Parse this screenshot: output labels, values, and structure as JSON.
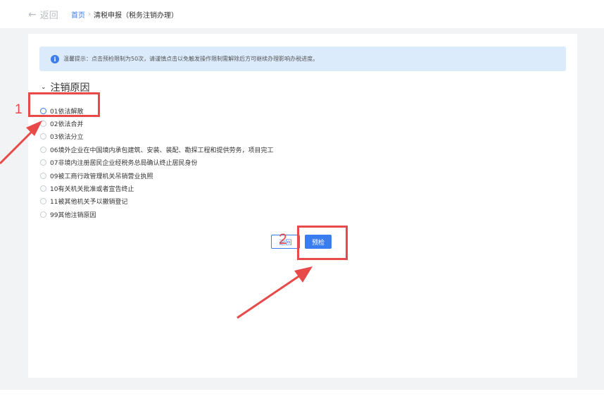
{
  "topbar": {
    "back_arrow": "←",
    "back_label": "返回",
    "breadcrumb": {
      "home": "首页",
      "separator": "›",
      "current": "清税申报（税务注销办理）"
    }
  },
  "notice": {
    "icon": "info-icon",
    "icon_glyph": "i",
    "text": "温馨提示：点击预检限制为50次，请谨慎点击以免触发操作限制需解除后方可继续办理影响办税进度。"
  },
  "section": {
    "chevron": "⌄",
    "title": "注销原因"
  },
  "reasons": [
    "01依法解散",
    "02依法合并",
    "03依法分立",
    "06境外企业在中国境内承包建筑、安装、装配、勘探工程和提供劳务，项目完工",
    "07非境内注册居民企业经税务总局确认终止居民身份",
    "09被工商行政管理机关吊销营业执照",
    "10有关机关批准或者宣告终止",
    "11被其他机关予以撤销登记",
    "99其他注销原因"
  ],
  "buttons": {
    "back": "返回",
    "precheck": "预检"
  },
  "annotations": {
    "step1": "1",
    "step2": "2",
    "color": "#e84a4a"
  },
  "colors": {
    "accent": "#3a7df0",
    "notice_bg": "#dcebfc",
    "page_bg": "#f2f3f5"
  }
}
